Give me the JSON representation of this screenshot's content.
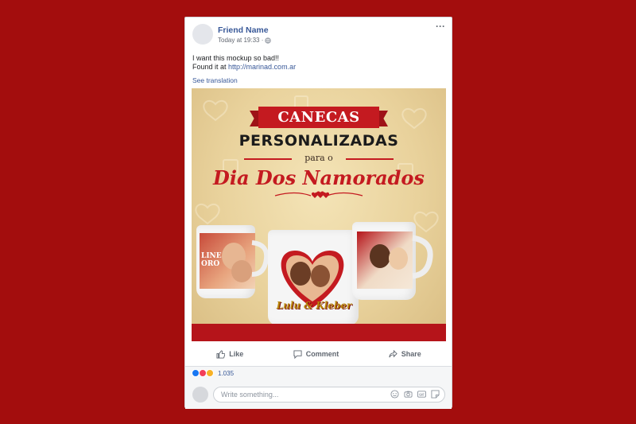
{
  "post": {
    "author": "Friend Name",
    "timestamp": "Today at 19:33 ·",
    "more_label": "···",
    "text_line1": "I want this mockup so bad!!",
    "text_line2_prefix": "Found it at ",
    "text_link": "http://marinad.com.ar",
    "see_translation": "See translation"
  },
  "ad": {
    "banner": "CANECAS",
    "headline": "PERSONALIZADAS",
    "subline": "para o",
    "script": "Dia Dos Namorados",
    "mug_left_text": "LINE ORO",
    "mug_center_text": "Lulu & Kleber"
  },
  "actions": {
    "like": "Like",
    "comment": "Comment",
    "share": "Share"
  },
  "reactions": {
    "count": "1.035"
  },
  "comment": {
    "placeholder": "Write something..."
  },
  "colors": {
    "background": "#a30d0d",
    "link": "#385898",
    "brand_red": "#c41a20"
  },
  "icons": [
    "globe-icon",
    "more-icon",
    "like-icon",
    "comment-icon",
    "share-icon",
    "emoji-icon",
    "camera-icon",
    "gif-icon",
    "sticker-icon"
  ]
}
